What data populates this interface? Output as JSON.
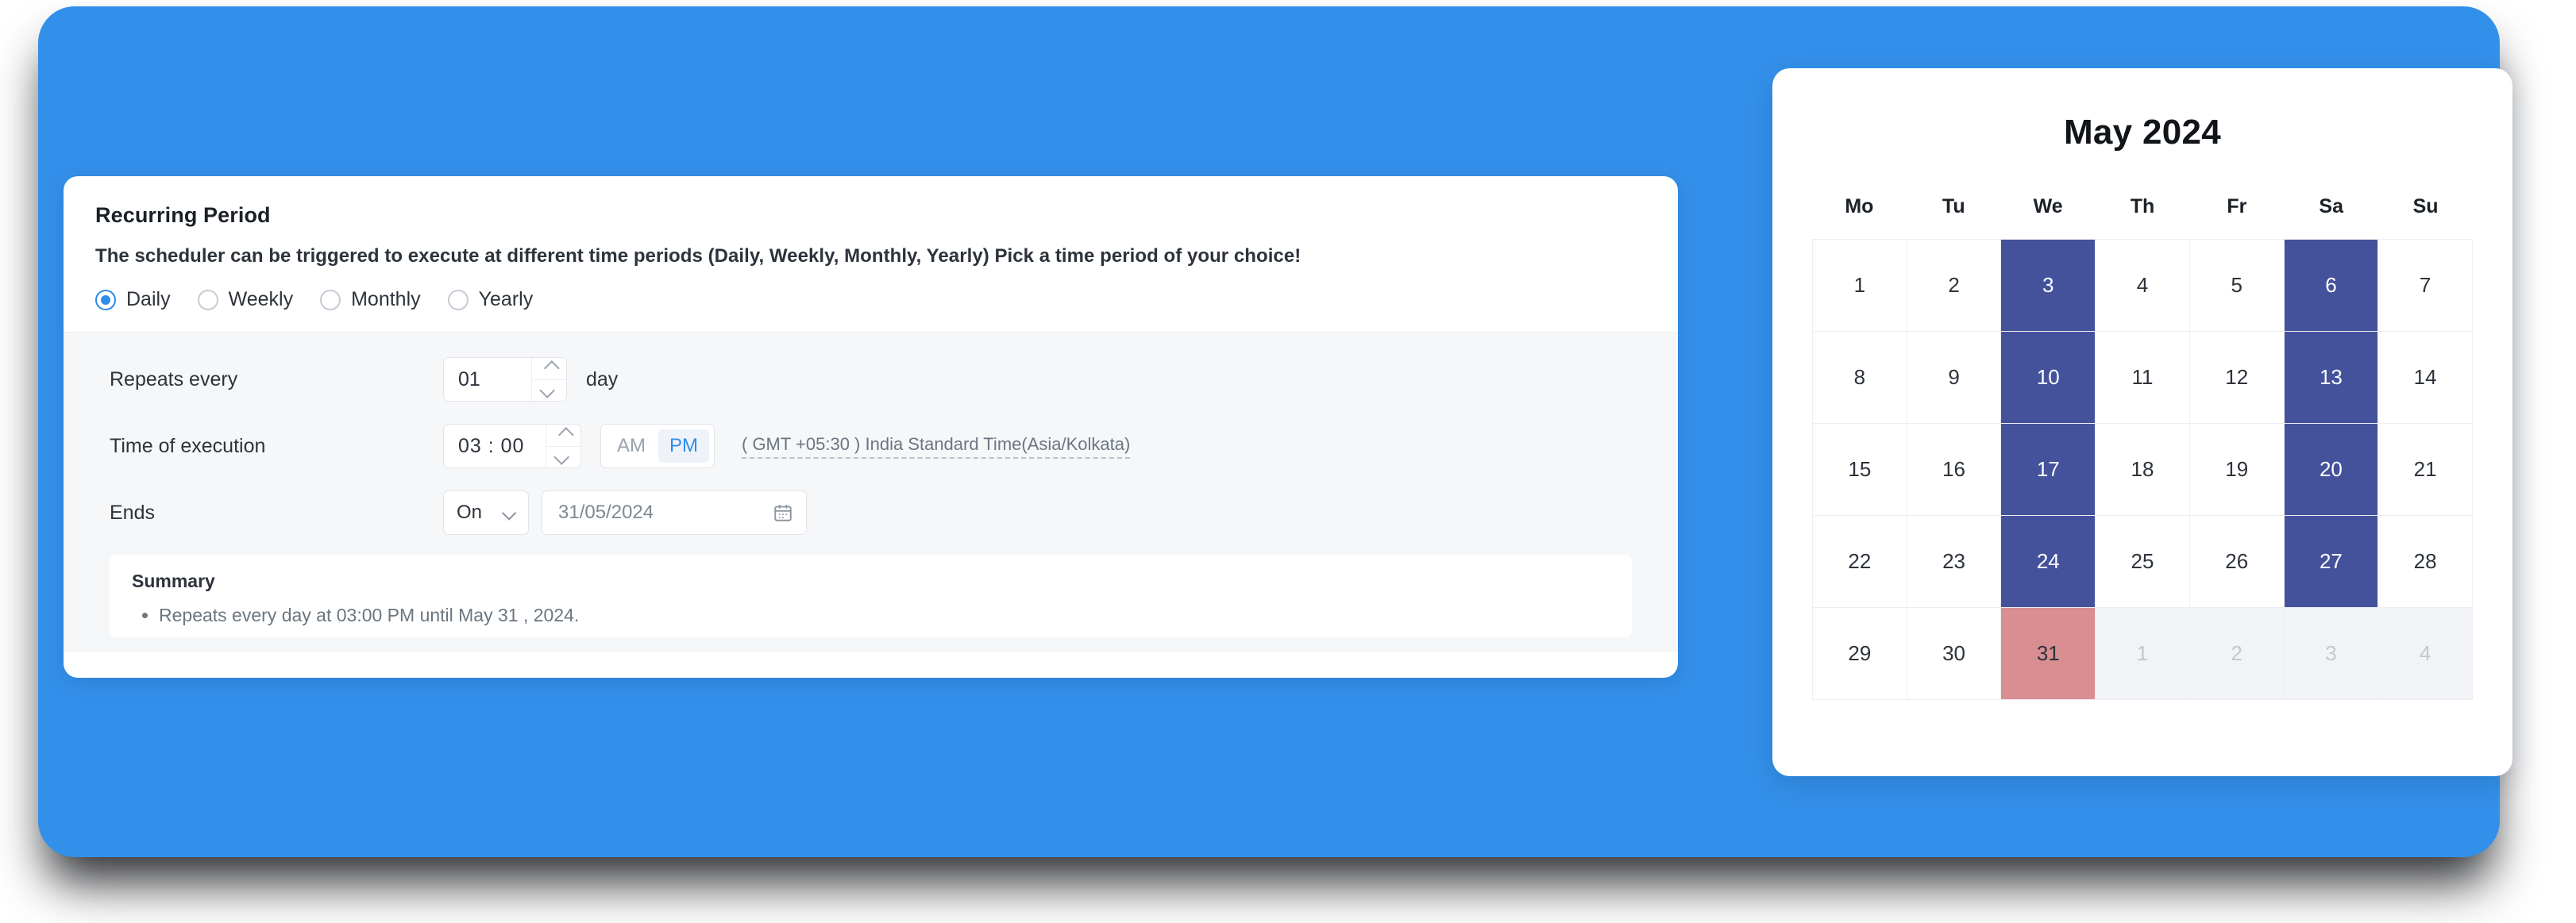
{
  "theme": {
    "background_blue": "#3390ea",
    "accent_blue": "#2f8ce8",
    "highlight_navy": "#44529c",
    "end_date_red": "#d98e91"
  },
  "form": {
    "title": "Recurring Period",
    "description": "The scheduler can be triggered to execute at different time periods (Daily, Weekly, Monthly, Yearly) Pick a time period of your choice!",
    "frequency_options": [
      {
        "label": "Daily",
        "selected": true
      },
      {
        "label": "Weekly",
        "selected": false
      },
      {
        "label": "Monthly",
        "selected": false
      },
      {
        "label": "Yearly",
        "selected": false
      }
    ],
    "repeats_every": {
      "label": "Repeats every",
      "value": "01",
      "unit": "day"
    },
    "time_of_execution": {
      "label": "Time of execution",
      "value": "03 : 00",
      "meridiem_options": [
        "AM",
        "PM"
      ],
      "meridiem_selected": "PM",
      "timezone": "( GMT +05:30 ) India Standard Time(Asia/Kolkata)"
    },
    "ends": {
      "label": "Ends",
      "mode": "On",
      "date": "31/05/2024"
    },
    "summary": {
      "title": "Summary",
      "items": [
        "Repeats every day at 03:00 PM until May 31 , 2024."
      ]
    }
  },
  "calendar": {
    "title": "May 2024",
    "weekdays": [
      "Mo",
      "Tu",
      "We",
      "Th",
      "Fr",
      "Sa",
      "Su"
    ],
    "cells": [
      {
        "day": "1",
        "state": "normal"
      },
      {
        "day": "2",
        "state": "normal"
      },
      {
        "day": "3",
        "state": "highlight"
      },
      {
        "day": "4",
        "state": "normal"
      },
      {
        "day": "5",
        "state": "normal"
      },
      {
        "day": "6",
        "state": "highlight"
      },
      {
        "day": "7",
        "state": "normal"
      },
      {
        "day": "8",
        "state": "normal"
      },
      {
        "day": "9",
        "state": "normal"
      },
      {
        "day": "10",
        "state": "highlight"
      },
      {
        "day": "11",
        "state": "normal"
      },
      {
        "day": "12",
        "state": "normal"
      },
      {
        "day": "13",
        "state": "highlight"
      },
      {
        "day": "14",
        "state": "normal"
      },
      {
        "day": "15",
        "state": "normal"
      },
      {
        "day": "16",
        "state": "normal"
      },
      {
        "day": "17",
        "state": "highlight"
      },
      {
        "day": "18",
        "state": "normal"
      },
      {
        "day": "19",
        "state": "normal"
      },
      {
        "day": "20",
        "state": "highlight"
      },
      {
        "day": "21",
        "state": "normal"
      },
      {
        "day": "22",
        "state": "normal"
      },
      {
        "day": "23",
        "state": "normal"
      },
      {
        "day": "24",
        "state": "highlight"
      },
      {
        "day": "25",
        "state": "normal"
      },
      {
        "day": "26",
        "state": "normal"
      },
      {
        "day": "27",
        "state": "highlight"
      },
      {
        "day": "28",
        "state": "normal"
      },
      {
        "day": "29",
        "state": "normal"
      },
      {
        "day": "30",
        "state": "normal"
      },
      {
        "day": "31",
        "state": "end-date"
      },
      {
        "day": "1",
        "state": "muted"
      },
      {
        "day": "2",
        "state": "muted"
      },
      {
        "day": "3",
        "state": "muted"
      },
      {
        "day": "4",
        "state": "muted"
      }
    ]
  }
}
